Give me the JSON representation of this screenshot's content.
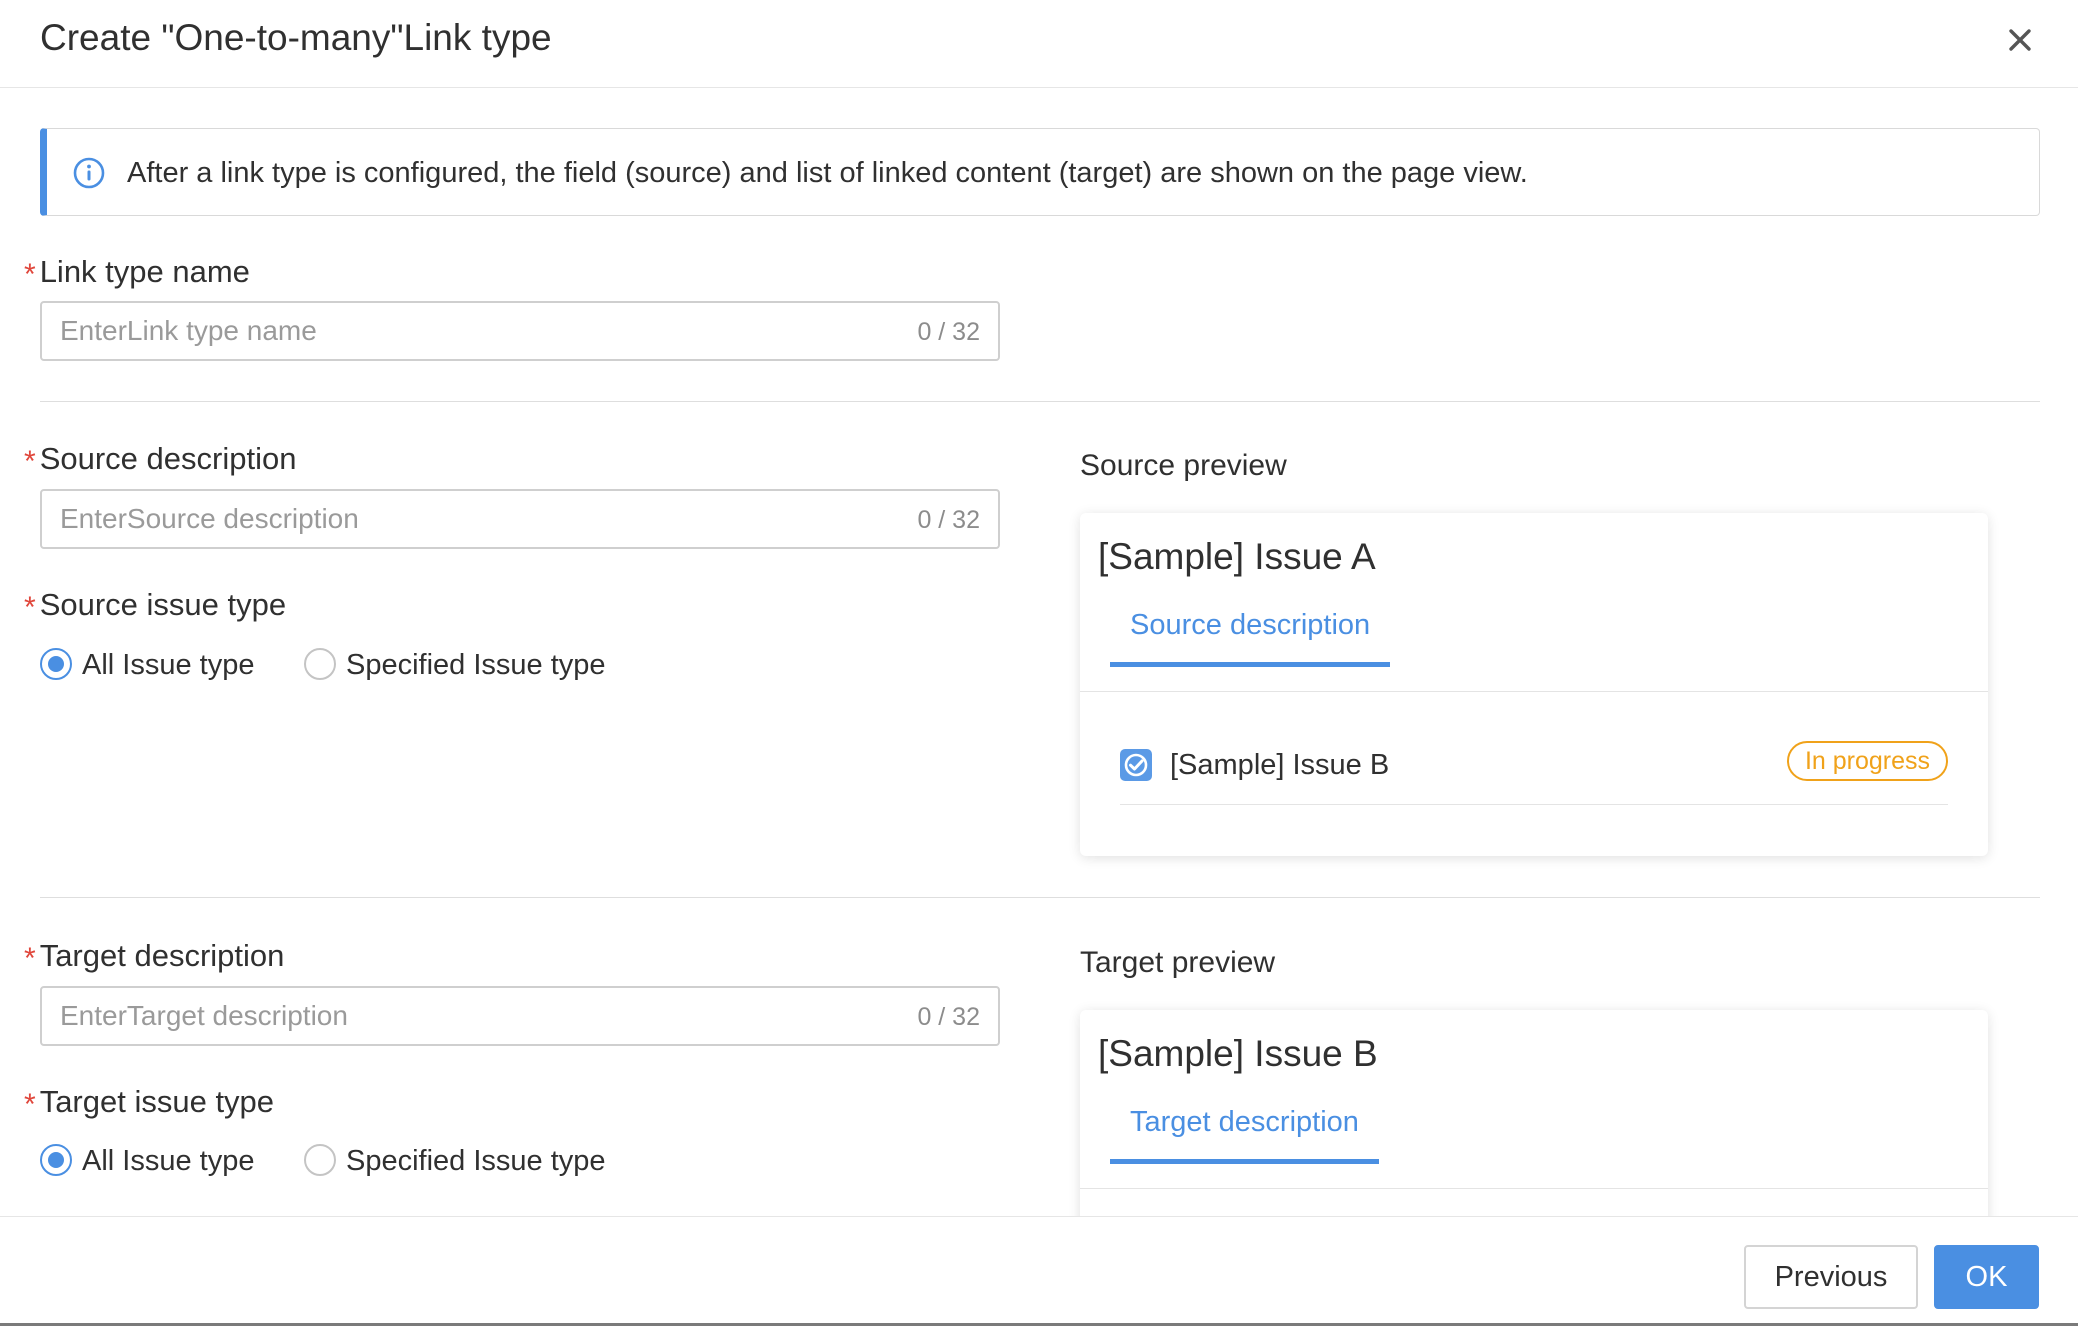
{
  "dialog": {
    "title": "Create \"One-to-many\"Link type"
  },
  "banner": {
    "text": "After a link type is configured, the field (source) and list of linked content (target) are shown on the page view."
  },
  "link_type_name": {
    "label": "Link type name",
    "placeholder": "EnterLink type name",
    "counter": "0 / 32"
  },
  "source": {
    "description_label": "Source description",
    "description_placeholder": "EnterSource description",
    "description_counter": "0 / 32",
    "issue_type_label": "Source issue type",
    "options": [
      "All Issue type",
      "Specified Issue type"
    ],
    "selected": "All Issue type"
  },
  "target": {
    "description_label": "Target description",
    "description_placeholder": "EnterTarget description",
    "description_counter": "0 / 32",
    "issue_type_label": "Target issue type",
    "options": [
      "All Issue type",
      "Specified Issue type"
    ],
    "selected": "All Issue type"
  },
  "source_preview": {
    "heading": "Source preview",
    "card_title": "[Sample] Issue A",
    "tab_label": "Source description",
    "row_text": "[Sample] Issue B",
    "status": "In progress"
  },
  "target_preview": {
    "heading": "Target preview",
    "card_title": "[Sample] Issue B",
    "tab_label": "Target description"
  },
  "footer": {
    "previous_label": "Previous",
    "ok_label": "OK"
  },
  "colors": {
    "accent": "#4a8fe2",
    "required": "#e0463b",
    "status_in_progress": "#f0a21a"
  }
}
